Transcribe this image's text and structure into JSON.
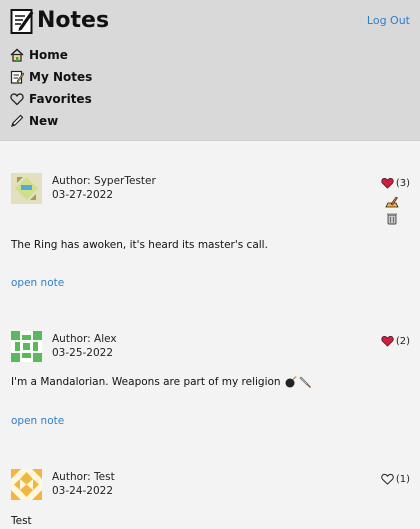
{
  "app": {
    "title": "Notes",
    "logout_label": "Log Out"
  },
  "nav": {
    "items": [
      {
        "label": "Home",
        "icon": "home-icon"
      },
      {
        "label": "My Notes",
        "icon": "notepad-icon"
      },
      {
        "label": "Favorites",
        "icon": "heart-outline-icon"
      },
      {
        "label": "New",
        "icon": "pen-icon"
      }
    ]
  },
  "notes": [
    {
      "author": "Author: SyperTester",
      "date": "03-27-2022",
      "text": "The Ring has awoken, it's heard its master's call.",
      "link": "open note",
      "likes": "(3)",
      "liked": true,
      "actions": [
        "edit-icon",
        "trash-icon"
      ]
    },
    {
      "author": "Author: Alex",
      "date": "03-25-2022",
      "text": "I'm a Mandalorian. Weapons are part of my religion",
      "link": "open note",
      "likes": "(2)",
      "liked": true,
      "emoji": [
        "bomb-icon",
        "dagger-icon"
      ]
    },
    {
      "author": "Author: Test",
      "date": "03-24-2022",
      "text": "Test",
      "likes": "(1)",
      "liked": false
    }
  ],
  "colors": {
    "header_bg": "#d9d9d9",
    "page_bg": "#f3f3f3",
    "link": "#2f7fc8",
    "heart": "#d81b3c"
  }
}
